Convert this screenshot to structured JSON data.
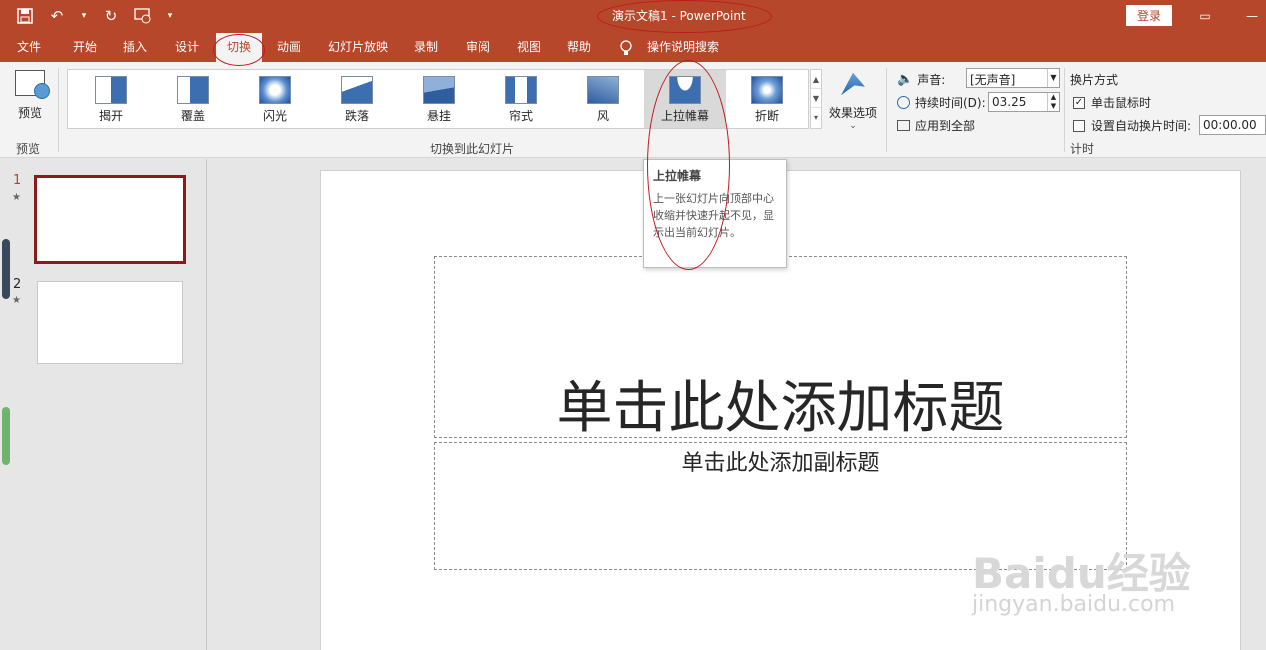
{
  "titlebar": {
    "app_title": "演示文稿1  -  PowerPoint",
    "login": "登录"
  },
  "tabs": [
    "文件",
    "开始",
    "插入",
    "设计",
    "切换",
    "动画",
    "幻灯片放映",
    "录制",
    "审阅",
    "视图",
    "帮助"
  ],
  "active_tab": "切换",
  "tell_me": "操作说明搜索",
  "ribbon": {
    "preview_label": "预览",
    "preview_group": "预览",
    "transitions": [
      "揭开",
      "覆盖",
      "闪光",
      "跌落",
      "悬挂",
      "帘式",
      "风",
      "上拉帷幕",
      "折断"
    ],
    "hovered_transition": "上拉帷幕",
    "effect_options": "效果选项",
    "transitions_group": "切换到此幻灯片",
    "sound_label": "声音:",
    "sound_value": "[无声音]",
    "duration_label": "持续时间(D):",
    "duration_value": "03.25",
    "apply_all": "应用到全部",
    "advance_header": "换片方式",
    "on_click": "单击鼠标时",
    "on_click_checked": true,
    "after_label": "设置自动换片时间:",
    "after_checked": false,
    "after_value": "00:00.00",
    "timing_group": "计时"
  },
  "slides": [
    {
      "number": "1",
      "star": "★"
    },
    {
      "number": "2",
      "star": "★"
    }
  ],
  "slide": {
    "title_placeholder": "单击此处添加标题",
    "subtitle_placeholder": "单击此处添加副标题"
  },
  "tooltip": {
    "title": "上拉帷幕",
    "body": "上一张幻灯片向顶部中心收缩并快速升起不见，显示出当前幻灯片。"
  },
  "watermark": {
    "brand": "Baidu经验",
    "url": "jingyan.baidu.com"
  },
  "colors": {
    "accent": "#b7472a",
    "selected_slide_border": "#8b1a1a",
    "annotation": "#c0181d"
  }
}
